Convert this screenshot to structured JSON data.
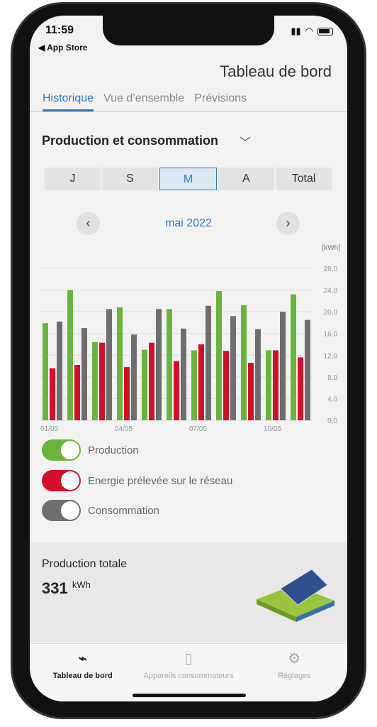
{
  "status": {
    "time": "11:59",
    "back": "◀ App Store"
  },
  "header": {
    "title": "Tableau de bord"
  },
  "tabs": [
    {
      "label": "Historique",
      "active": true
    },
    {
      "label": "Vue d’ensemble"
    },
    {
      "label": "Prévisions"
    }
  ],
  "section": {
    "title": "Production et consommation"
  },
  "periods": [
    "J",
    "S",
    "M",
    "A",
    "Total"
  ],
  "selected_period": "M",
  "month": "mai 2022",
  "chart_data": {
    "type": "bar",
    "unit": "[kWh]",
    "categories": [
      "01/05",
      "02/05",
      "03/05",
      "04/05",
      "05/05",
      "06/05",
      "07/05",
      "08/05",
      "09/05",
      "10/05",
      "11/05"
    ],
    "x_tick_labels": [
      "01/05",
      "04/05",
      "07/05",
      "10/05"
    ],
    "y_ticks": [
      "0,0",
      "4,0",
      "8,0",
      "12,0",
      "16,0",
      "20,0",
      "24,0",
      "28,0"
    ],
    "ylim": [
      0,
      28
    ],
    "grid": true,
    "series": [
      {
        "name": "Production",
        "color": "#6ab43e",
        "values": [
          17.9,
          24.0,
          14.4,
          20.8,
          13.0,
          20.5,
          12.9,
          23.8,
          21.2,
          12.9,
          23.2
        ]
      },
      {
        "name": "Energie prélevée sur le réseau",
        "color": "#d2102a",
        "values": [
          9.6,
          10.2,
          14.3,
          9.8,
          14.3,
          10.9,
          14.0,
          12.8,
          10.6,
          12.9,
          11.6
        ]
      },
      {
        "name": "Consommation",
        "color": "#6e6e6e",
        "values": [
          18.2,
          17.0,
          20.5,
          15.8,
          20.5,
          16.9,
          21.1,
          19.2,
          16.8,
          20.0,
          18.5
        ]
      }
    ]
  },
  "card": {
    "label": "Production totale",
    "value": "331",
    "unit": "kWh"
  },
  "bottom_nav": [
    {
      "label": "Tableau de bord",
      "icon": "plug-icon",
      "active": true
    },
    {
      "label": "Appareils consommateurs",
      "icon": "device-icon"
    },
    {
      "label": "Réglages",
      "icon": "gear-icon"
    }
  ]
}
